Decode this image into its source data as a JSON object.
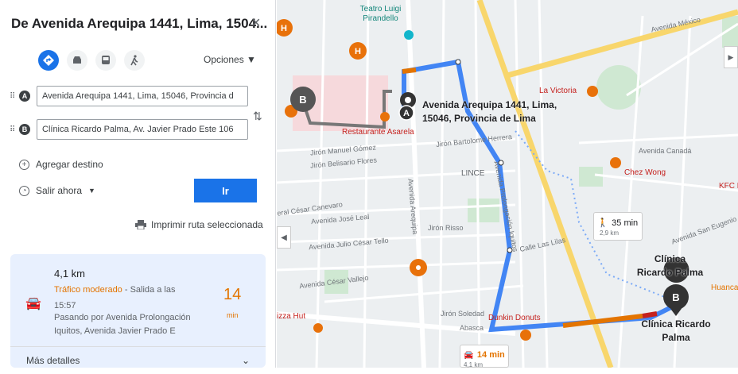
{
  "panel": {
    "title": "De Avenida Arequipa 1441, Lima, 1504...",
    "close": "×",
    "options": "Opciones ▼",
    "origin_value": "Avenida Arequipa 1441, Lima, 15046, Provincia d",
    "destination_value": "Clínica Ricardo Palma, Av. Javier Prado Este 106",
    "origin_badge": "A",
    "destination_badge": "B",
    "add_destination": "Agregar destino",
    "leave_now": "Salir ahora",
    "go_button": "Ir",
    "print_route": "Imprimir ruta seleccionada"
  },
  "route_card": {
    "distance": "4,1 km",
    "traffic": "Tráfico moderado",
    "departure": " - Salida a las 15:57",
    "via": "Pasando por Avenida Prolongación Iquitos, Avenida Javier Prado E",
    "duration": "14",
    "duration_unit": "min",
    "more_details": "Más detalles"
  },
  "map": {
    "origin_label": "Avenida Arequipa 1441, Lima, 15046, Provincia de Lima",
    "dest_label": "Clínica Ricardo Palma",
    "dest_label_top": "Clínica Ricardo Palma",
    "walk_time": "35 min",
    "walk_dist": "2,9 km",
    "drive_time": "14 min",
    "drive_dist": "4,1 km",
    "pois": [
      "Teatro Luigi Pirandello",
      "Restaurante Asarela",
      "La Victoria",
      "Chez Wong",
      "KFC Pe",
      "Dunkin Donuts",
      "izza Hut",
      "Huanca",
      "LINCE"
    ],
    "streets": [
      "Avenida México",
      "Jirón Manuel Gómez",
      "Jirón Belisario Flores",
      "Jirón Bartolomé Herrera",
      "Avenida Canadá",
      "Avenida Arequipa",
      "Avenida José Leal",
      "Avenida Julio César Tello",
      "Avenida César Vallejo",
      "Calle Las Lilas",
      "Avenida Prolongación Iquitos",
      "Avenida San Eugenio",
      "eral César Canevaro",
      "Jirón Risso",
      "Jirón Soledad",
      "Abasca"
    ]
  },
  "colors": {
    "accent": "#1a73e8",
    "route": "#4285f4",
    "traffic": "#e37400",
    "poi": "#e8710a"
  }
}
